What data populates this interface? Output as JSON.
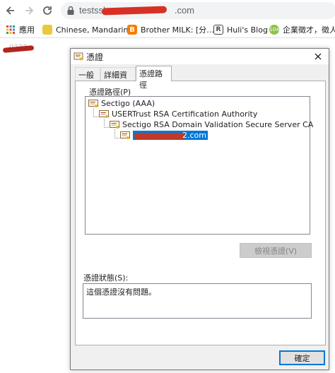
{
  "browser": {
    "url_prefix": "testssl",
    "url_suffix": ".com",
    "bookmarks": [
      {
        "label": "應用",
        "icon": "apps-grid-icon",
        "color": "#4285f4"
      },
      {
        "label": "Chinese, Mandarin...",
        "icon": "site-favicon-icon",
        "color": "#e9c83b"
      },
      {
        "label": "Brother MILK: [分...",
        "icon": "blogger-icon",
        "color": "#f57d00"
      },
      {
        "label": "Huli's Blog",
        "icon": "huli-favicon-icon",
        "color": "#444444"
      },
      {
        "label": "企業徵才，徵人",
        "icon": "jobs-favicon-icon",
        "color": "#8bc34a"
      }
    ],
    "page_text": ".0222"
  },
  "dialog": {
    "title": "憑證",
    "tabs": [
      {
        "label": "一般",
        "active": false
      },
      {
        "label": "詳細資料",
        "active": false
      },
      {
        "label": "憑證路徑",
        "active": true
      }
    ],
    "path_label": "憑證路徑(P)",
    "chain": [
      {
        "label": "Sectigo (AAA)"
      },
      {
        "label": "USERTrust RSA Certification Authority"
      },
      {
        "label": "Sectigo RSA Domain Validation Secure Server CA"
      },
      {
        "label": "2.com",
        "selected": true
      }
    ],
    "view_cert_button": "檢視憑證(V)",
    "status_label": "憑證狀態(S):",
    "status_text": "這個憑證沒有問題。",
    "ok_button": "確定"
  },
  "colors": {
    "selection": "#0078d7",
    "redaction": "#c0392b",
    "accent_border": "#0078d7"
  }
}
